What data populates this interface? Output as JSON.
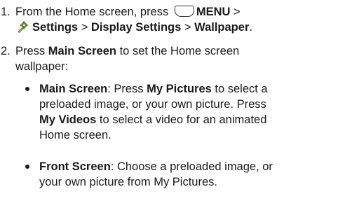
{
  "steps": [
    {
      "number": "1.",
      "line1": {
        "pre": "From the Home screen, press",
        "menu": "MENU",
        "sep": ">"
      },
      "line2": {
        "settings": "Settings",
        "sep1": ">",
        "display": "Display Settings",
        "sep2": ">",
        "wallpaper": "Wallpaper",
        "end": "."
      }
    },
    {
      "number": "2.",
      "line1": {
        "pre": "Press",
        "bold": "Main Screen",
        "post": "to set the Home screen"
      },
      "line2": "wallpaper:"
    }
  ],
  "bullets": [
    {
      "title": "Main Screen",
      "l1": ": Press",
      "b1": "My Pictures",
      "l1b": "to select a",
      "l2": "preloaded image, or your own picture. Press",
      "b2": "My Videos",
      "l3": "to select a video for an animated",
      "l4": "Home screen."
    },
    {
      "title": "Front Screen",
      "l1": ": Choose a preloaded image, or",
      "l2": "your own picture from My Pictures."
    }
  ],
  "icons": {
    "menu_key": "menu-key-icon",
    "settings": "settings-gear-icon"
  },
  "colors": {
    "text": "#1a1a1a",
    "gear_green": "#6a9a2a"
  }
}
